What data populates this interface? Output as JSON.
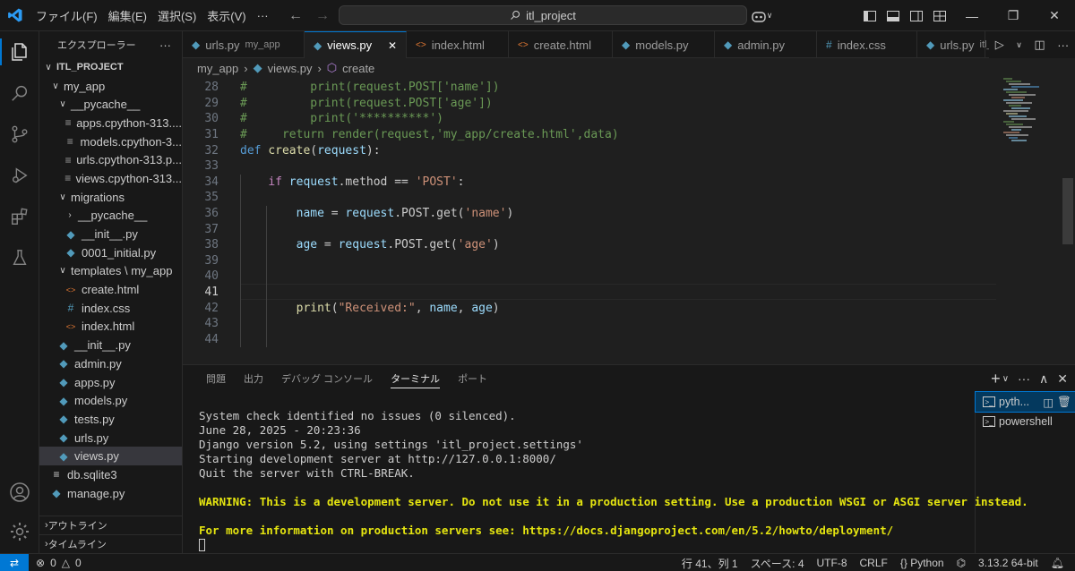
{
  "menu": [
    "ファイル(F)",
    "編集(E)",
    "選択(S)",
    "表示(V)",
    "···"
  ],
  "command_center": "itl_project",
  "sidebar": {
    "title": "エクスプローラー",
    "more": "···",
    "project": "ITL_PROJECT",
    "rows": [
      {
        "label": "my_app",
        "indent": 1,
        "type": "folder-open"
      },
      {
        "label": "__pycache__",
        "indent": 2,
        "type": "folder-open"
      },
      {
        "label": "apps.cpython-313....",
        "indent": 3,
        "type": "list"
      },
      {
        "label": "models.cpython-3...",
        "indent": 3,
        "type": "list"
      },
      {
        "label": "urls.cpython-313.p...",
        "indent": 3,
        "type": "list"
      },
      {
        "label": "views.cpython-313...",
        "indent": 3,
        "type": "list"
      },
      {
        "label": "migrations",
        "indent": 2,
        "type": "folder-open"
      },
      {
        "label": "__pycache__",
        "indent": 3,
        "type": "folder-closed"
      },
      {
        "label": "__init__.py",
        "indent": 3,
        "type": "py"
      },
      {
        "label": "0001_initial.py",
        "indent": 3,
        "type": "py"
      },
      {
        "label": "templates \\ my_app",
        "indent": 2,
        "type": "folder-open"
      },
      {
        "label": "create.html",
        "indent": 3,
        "type": "html"
      },
      {
        "label": "index.css",
        "indent": 3,
        "type": "css"
      },
      {
        "label": "index.html",
        "indent": 3,
        "type": "html"
      },
      {
        "label": "__init__.py",
        "indent": 2,
        "type": "py"
      },
      {
        "label": "admin.py",
        "indent": 2,
        "type": "py"
      },
      {
        "label": "apps.py",
        "indent": 2,
        "type": "py"
      },
      {
        "label": "models.py",
        "indent": 2,
        "type": "py"
      },
      {
        "label": "tests.py",
        "indent": 2,
        "type": "py"
      },
      {
        "label": "urls.py",
        "indent": 2,
        "type": "py"
      },
      {
        "label": "views.py",
        "indent": 2,
        "type": "py",
        "selected": true
      },
      {
        "label": "db.sqlite3",
        "indent": 1,
        "type": "db"
      },
      {
        "label": "manage.py",
        "indent": 1,
        "type": "py"
      }
    ],
    "outline": "アウトライン",
    "timeline": "タイムライン"
  },
  "tabs": [
    {
      "label": "urls.py",
      "desc": "my_app",
      "icon": "py"
    },
    {
      "label": "views.py",
      "desc": "",
      "icon": "py",
      "active": true,
      "close": "✕"
    },
    {
      "label": "index.html",
      "desc": "",
      "icon": "html"
    },
    {
      "label": "create.html",
      "desc": "",
      "icon": "html"
    },
    {
      "label": "models.py",
      "desc": "",
      "icon": "py"
    },
    {
      "label": "admin.py",
      "desc": "",
      "icon": "py"
    },
    {
      "label": "index.css",
      "desc": "",
      "icon": "css"
    },
    {
      "label": "urls.py",
      "desc": "itl_",
      "icon": "py"
    }
  ],
  "breadcrumb": [
    "my_app",
    "views.py",
    "create"
  ],
  "code": {
    "current_line": 41,
    "lines": [
      {
        "n": "28",
        "tokens": [
          [
            "cmt",
            "#         print(request.POST['name'])"
          ]
        ]
      },
      {
        "n": "29",
        "tokens": [
          [
            "cmt",
            "#         print(request.POST['age'])"
          ]
        ]
      },
      {
        "n": "30",
        "tokens": [
          [
            "cmt",
            "#         print('**********')"
          ]
        ]
      },
      {
        "n": "31",
        "tokens": [
          [
            "cmt",
            "#     return render(request,'my_app/create.html',data)"
          ]
        ]
      },
      {
        "n": "32",
        "tokens": [
          [
            "kw",
            "def "
          ],
          [
            "fn",
            "create"
          ],
          [
            "",
            "("
          ],
          [
            "var",
            "request"
          ],
          [
            "",
            "):"
          ]
        ]
      },
      {
        "n": "33",
        "tokens": []
      },
      {
        "n": "34",
        "tokens": [
          [
            "",
            "    "
          ],
          [
            "kw2",
            "if "
          ],
          [
            "var",
            "request"
          ],
          [
            "",
            ".method == "
          ],
          [
            "str",
            "'POST'"
          ],
          [
            "",
            ":"
          ]
        ]
      },
      {
        "n": "35",
        "tokens": []
      },
      {
        "n": "36",
        "tokens": [
          [
            "",
            "        "
          ],
          [
            "var",
            "name"
          ],
          [
            "",
            " = "
          ],
          [
            "var",
            "request"
          ],
          [
            "",
            ".POST.get("
          ],
          [
            "str",
            "'name'"
          ],
          [
            "",
            ")"
          ]
        ]
      },
      {
        "n": "37",
        "tokens": []
      },
      {
        "n": "38",
        "tokens": [
          [
            "",
            "        "
          ],
          [
            "var",
            "age"
          ],
          [
            "",
            " = "
          ],
          [
            "var",
            "request"
          ],
          [
            "",
            ".POST.get("
          ],
          [
            "str",
            "'age'"
          ],
          [
            "",
            ")"
          ]
        ]
      },
      {
        "n": "39",
        "tokens": []
      },
      {
        "n": "40",
        "tokens": []
      },
      {
        "n": "41",
        "tokens": []
      },
      {
        "n": "42",
        "tokens": [
          [
            "",
            "        "
          ],
          [
            "fn",
            "print"
          ],
          [
            "",
            "("
          ],
          [
            "str",
            "\"Received:\""
          ],
          [
            "",
            ", "
          ],
          [
            "var",
            "name"
          ],
          [
            "",
            ", "
          ],
          [
            "var",
            "age"
          ],
          [
            "",
            ")"
          ]
        ]
      },
      {
        "n": "43",
        "tokens": []
      },
      {
        "n": "44",
        "tokens": []
      }
    ]
  },
  "panel": {
    "tabs": [
      "問題",
      "出力",
      "デバッグ コンソール",
      "ターミナル",
      "ポート"
    ],
    "active_tab": "ターミナル",
    "actions": [
      "+",
      "∨",
      "···",
      "∧",
      "✕"
    ],
    "terminal_lines": [
      {
        "text": "",
        "warn": false
      },
      {
        "text": "System check identified no issues (0 silenced).",
        "warn": false
      },
      {
        "text": "June 28, 2025 - 20:23:36",
        "warn": false
      },
      {
        "text": "Django version 5.2, using settings 'itl_project.settings'",
        "warn": false
      },
      {
        "text": "Starting development server at http://127.0.0.1:8000/",
        "warn": false
      },
      {
        "text": "Quit the server with CTRL-BREAK.",
        "warn": false
      },
      {
        "text": "",
        "warn": false
      },
      {
        "text": "WARNING: This is a development server. Do not use it in a production setting. Use a production WSGI or ASGI server instead.",
        "warn": true
      },
      {
        "text": "",
        "warn": false
      },
      {
        "text": "For more information on production servers see: https://docs.djangoproject.com/en/5.2/howto/deployment/",
        "warn": true
      }
    ],
    "terminals": [
      {
        "label": "pyth...",
        "active": true
      },
      {
        "label": "powershell",
        "active": false
      }
    ]
  },
  "status": {
    "errors": "0",
    "warnings": "0",
    "position": "行 41、列 1",
    "spaces": "スペース: 4",
    "encoding": "UTF-8",
    "eol": "CRLF",
    "language": "Python",
    "interpreter": "3.13.2 64-bit"
  },
  "colors": {
    "accent": "#0078d4",
    "warning": "#e5e510",
    "comment": "#6a9955",
    "keyword": "#569cd6",
    "string": "#ce9178"
  }
}
